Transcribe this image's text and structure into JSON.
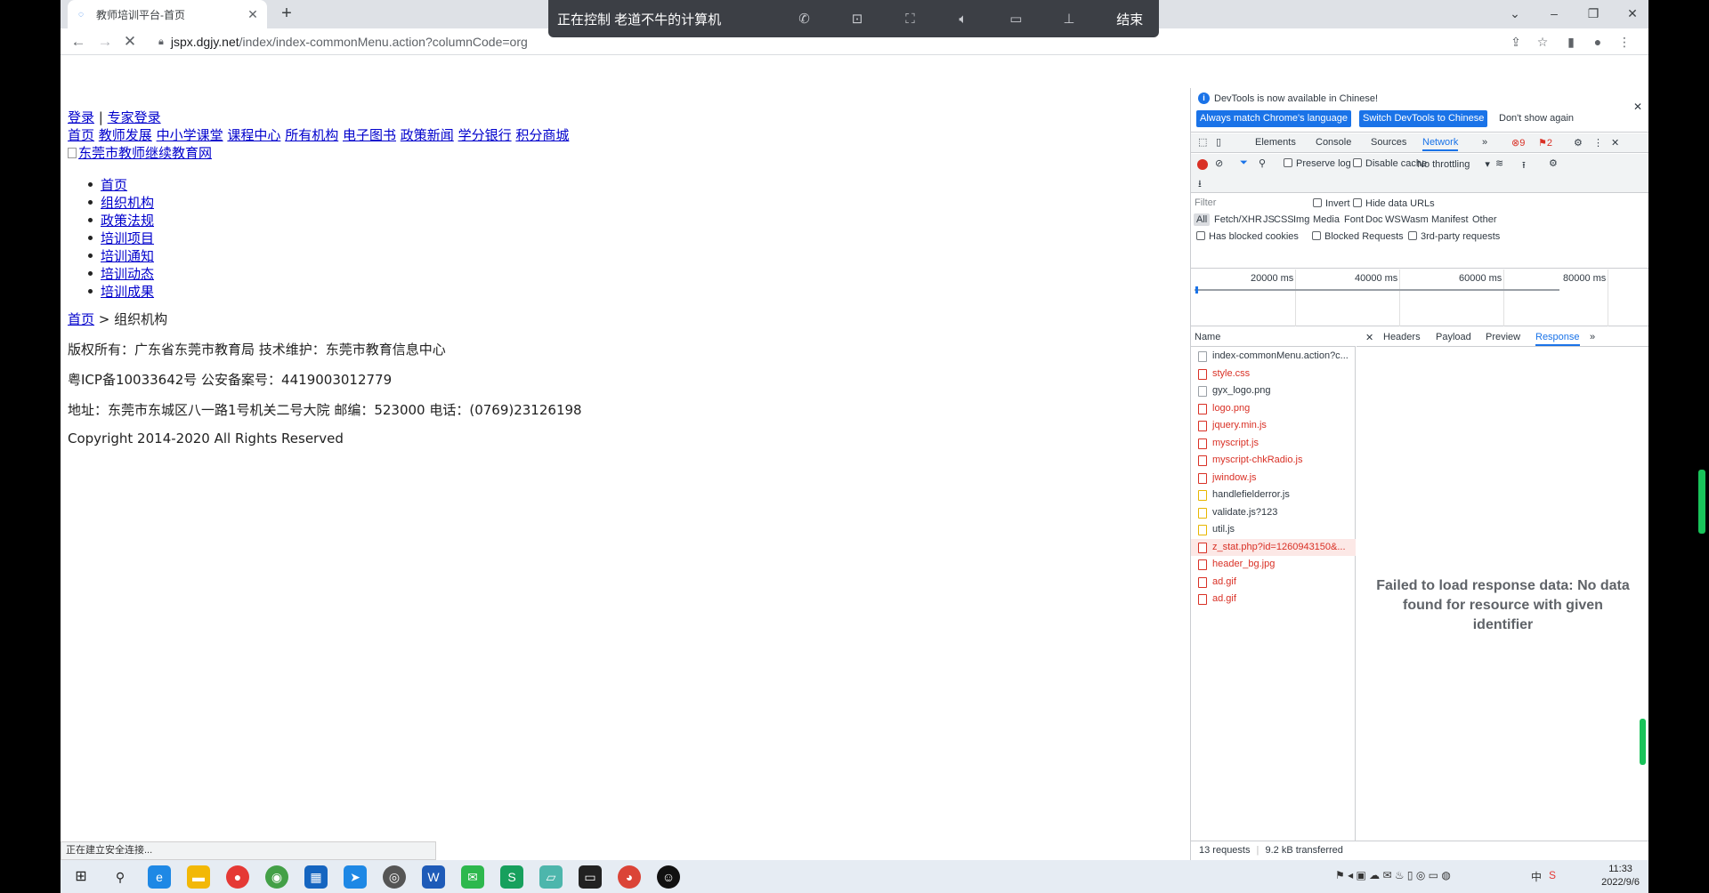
{
  "browser": {
    "tab_title": "教师培训平台-首页",
    "url_domain": "jspx.dgjy.net",
    "url_path": "/index/index-commonMenu.action?columnCode=org",
    "new_tab": "+"
  },
  "remote": {
    "title": "正在控制 老道不牛的计算机",
    "end_label": "结束",
    "icons": [
      "phone-icon",
      "ratio-1-1-icon",
      "fullscreen-icon",
      "volume-icon",
      "hd-icon",
      "pin-icon"
    ]
  },
  "page": {
    "login_link": "登录",
    "separator": "|",
    "expert_login_link": "专家登录",
    "nav_links": [
      "首页",
      "教师发展",
      "中小学课堂",
      "课程中心",
      "所有机构",
      "电子图书",
      "政策新闻",
      "学分银行",
      "积分商城"
    ],
    "logo_alt": "东莞市教师继续教育网",
    "menu_items": [
      "首页",
      "组织机构",
      "政策法规",
      "培训项目",
      "培训通知",
      "培训动态",
      "培训成果"
    ],
    "breadcrumb_home": "首页",
    "breadcrumb_sep": ">",
    "breadcrumb_current": "组织机构",
    "footer_line1": "版权所有：广东省东莞市教育局 技术维护：东莞市教育信息中心",
    "footer_line2": "粤ICP备10033642号 公安备案号：4419003012779",
    "footer_line3": "地址：东莞市东城区八一路1号机关二号大院 邮编：523000 电话：(0769)23126198",
    "footer_line4": "Copyright 2014-2020 All Rights Reserved",
    "status_text": "正在建立安全连接..."
  },
  "devtools": {
    "info_text": "DevTools is now available in Chinese!",
    "btn_match": "Always match Chrome's language",
    "btn_switch": "Switch DevTools to Chinese",
    "btn_dont_show": "Don't show again",
    "tabs": [
      "Elements",
      "Console",
      "Sources",
      "Network"
    ],
    "active_tab": "Network",
    "more_tabs": "»",
    "error_count": "9",
    "issue_count": "2",
    "preserve_log": "Preserve log",
    "disable_cache": "Disable cache",
    "throttling": "No throttling",
    "filter_placeholder": "Filter",
    "invert": "Invert",
    "hide_data_urls": "Hide data URLs",
    "type_filters": [
      "All",
      "Fetch/XHR",
      "JS",
      "CSS",
      "Img",
      "Media",
      "Font",
      "Doc",
      "WS",
      "Wasm",
      "Manifest",
      "Other"
    ],
    "has_blocked_cookies": "Has blocked cookies",
    "blocked_requests": "Blocked Requests",
    "third_party": "3rd-party requests",
    "timeline_ticks": [
      "20000 ms",
      "40000 ms",
      "60000 ms",
      "80000 ms"
    ],
    "name_header": "Name",
    "requests": [
      {
        "name": "index-commonMenu.action?c...",
        "status": "doc"
      },
      {
        "name": "style.css",
        "status": "error"
      },
      {
        "name": "gyx_logo.png",
        "status": "ok"
      },
      {
        "name": "logo.png",
        "status": "error"
      },
      {
        "name": "jquery.min.js",
        "status": "error"
      },
      {
        "name": "myscript.js",
        "status": "error"
      },
      {
        "name": "myscript-chkRadio.js",
        "status": "error"
      },
      {
        "name": "jwindow.js",
        "status": "error"
      },
      {
        "name": "handlefielderror.js",
        "status": "js"
      },
      {
        "name": "validate.js?123",
        "status": "js"
      },
      {
        "name": "util.js",
        "status": "js"
      },
      {
        "name": "z_stat.php?id=1260943150&...",
        "status": "selected"
      },
      {
        "name": "header_bg.jpg",
        "status": "error"
      },
      {
        "name": "ad.gif",
        "status": "error"
      },
      {
        "name": "ad.gif",
        "status": "error"
      }
    ],
    "detail_tabs": [
      "Headers",
      "Payload",
      "Preview",
      "Response"
    ],
    "active_detail": "Response",
    "fail_message": "Failed to load response data: No data found for resource with given identifier",
    "requests_count": "13 requests",
    "transferred": "9.2 kB transferred"
  },
  "taskbar": {
    "time": "11:33",
    "date": "2022/9/6",
    "ime": "中"
  }
}
